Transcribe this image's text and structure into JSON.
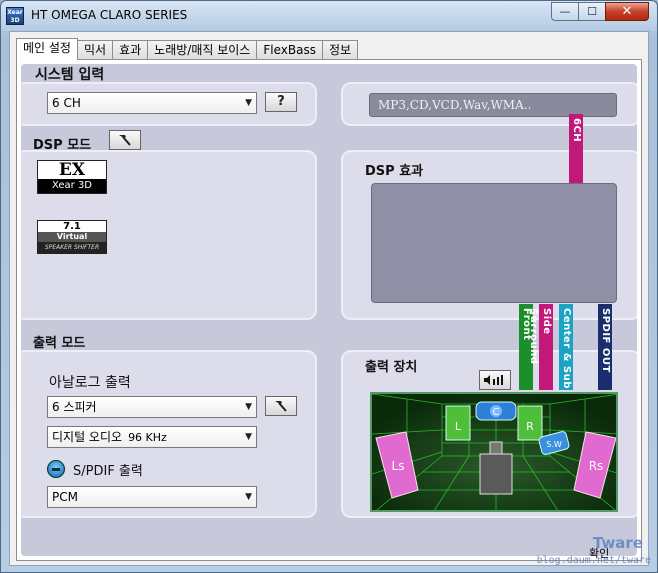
{
  "window": {
    "app_icon_text": "Xear 3D",
    "title": "HT OMEGA CLARO SERIES",
    "minimize_glyph": "—",
    "maximize_glyph": "☐",
    "close_glyph": "✕"
  },
  "tabs": [
    {
      "label": "메인 설정"
    },
    {
      "label": "믹서"
    },
    {
      "label": "효과"
    },
    {
      "label": "노래방/매직 보이스"
    },
    {
      "label": "FlexBass"
    },
    {
      "label": "정보"
    }
  ],
  "system_input": {
    "heading": "시스템 입력",
    "select_value": "6 CH",
    "help_label": "?",
    "sources_text": "MP3,CD,VCD,Wav,WMA.."
  },
  "dsp_mode": {
    "heading": "DSP 모드",
    "ex_logo": {
      "top": "EX",
      "bottom": "Xear 3D"
    },
    "virtual_logo": {
      "line1": "7.1",
      "line2": "Virtual",
      "line3": "SPEAKER SHIFTER"
    }
  },
  "dsp_effect": {
    "heading": "DSP 효과",
    "channel_label": "6CH",
    "channel_color": "#c2187a"
  },
  "output_mode": {
    "heading": "출력 모드",
    "analog_heading": "아날로그 출력",
    "analog_value": "6 스피커",
    "digital_value": "디지털 오디오",
    "digital_rate": "96 KHz",
    "spdif_heading": "S/PDIF 출력",
    "spdif_value": "PCM"
  },
  "output_device": {
    "heading": "출력 장치",
    "channels": [
      {
        "label": "Front",
        "color": "#1a8f2a"
      },
      {
        "label": "Side Surround",
        "color": "#c2187a"
      },
      {
        "label": "Center & Sub",
        "color": "#1aa3c2"
      },
      {
        "label": "SPDIF OUT",
        "color": "#1a2e6e"
      }
    ],
    "speakers": {
      "L": "L",
      "C": "C",
      "R": "R",
      "SW": "S.W",
      "Ls": "Ls",
      "Rs": "Rs"
    }
  },
  "footer": {
    "watermark": "Tware",
    "watermark_url": "blog.daum.net/tware",
    "ok_label": "확인"
  }
}
